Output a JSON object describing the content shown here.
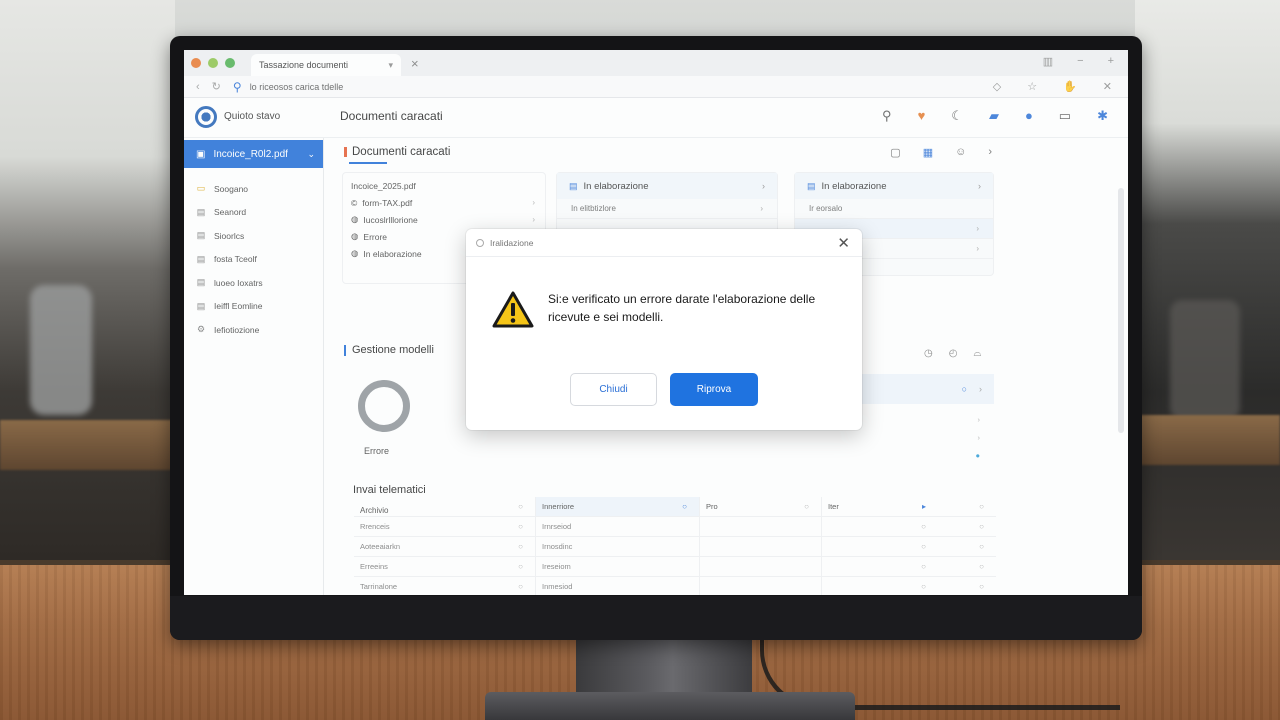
{
  "browser": {
    "tab_title": "Tassazione documenti",
    "url": "lo riceosos carica tdelle"
  },
  "app": {
    "name": "Quioto stavo",
    "page_title": "Documenti caracati"
  },
  "sidebar": {
    "active_item": "Incoice_R0l2.pdf",
    "items": [
      {
        "label": "Soogano",
        "icon": "folder-icon"
      },
      {
        "label": "Seanord",
        "icon": "document-icon"
      },
      {
        "label": "Sioorlcs",
        "icon": "document-icon"
      },
      {
        "label": "fosta Tceolf",
        "icon": "document-icon"
      },
      {
        "label": "luoeo Ioxatrs",
        "icon": "document-icon"
      },
      {
        "label": "Ieiffl Eomline",
        "icon": "document-icon"
      },
      {
        "label": "Iefiotiozione",
        "icon": "settings-icon"
      }
    ]
  },
  "main": {
    "section_title": "Documenti caracati",
    "file_list": [
      "Incoice_2025.pdf",
      "form-TAX.pdf",
      "Iucoslrlllorione",
      "Errore",
      "In elaborazione"
    ],
    "card2": {
      "title": "In elaborazione",
      "rows": [
        "In elitbtizlore"
      ]
    },
    "card3": {
      "title": "In elaborazione",
      "rows": [
        "Ir eorsalo"
      ]
    },
    "models_title": "Gestione modelli",
    "donut_label": "Errore",
    "telematics_title": "Invai telematici",
    "archive_label": "Archivio",
    "table": {
      "header": [
        "",
        "Innerriore",
        "Pro",
        "Iter"
      ],
      "rows": [
        [
          "Rrenceis",
          "Irnrseiod",
          "",
          ""
        ],
        [
          "Aoteeaiarkn",
          "Irnosdinc",
          "",
          ""
        ],
        [
          "Erreeins",
          "Ireseiom",
          "",
          ""
        ],
        [
          "Tarrinalone",
          "Inmesiod",
          "",
          ""
        ]
      ]
    }
  },
  "modal": {
    "header": "Iralidazione",
    "message": "Si:e verificato un errore darate l'elaborazione delle ricevute e sei modelli.",
    "close_label": "Chiudi",
    "retry_label": "Riprova"
  }
}
